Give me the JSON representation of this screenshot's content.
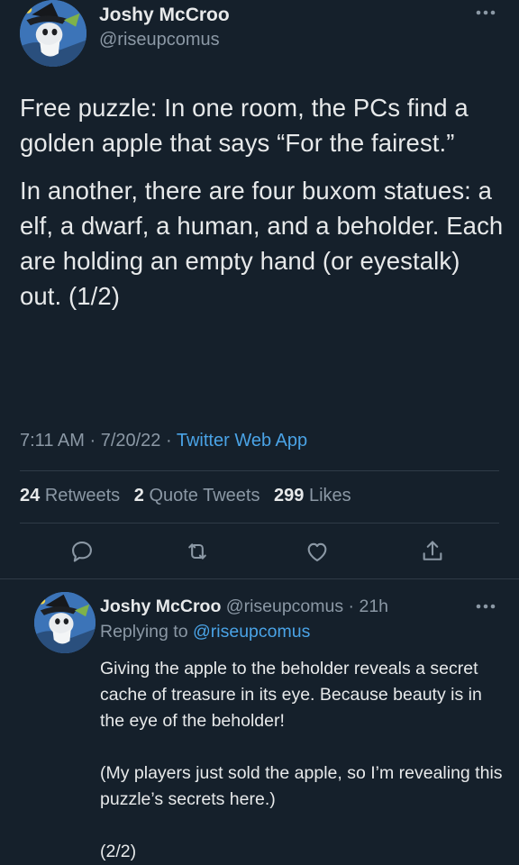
{
  "main_tweet": {
    "author": {
      "name": "Joshy McCroo",
      "handle": "@riseupcomus"
    },
    "body": [
      "Free puzzle: In one room, the PCs find a golden apple that says “For the fairest.”",
      "In another, there are four buxom statues: a elf, a dwarf, a human, and a beholder. Each are holding an empty hand (or eyestalk) out. (1/2)"
    ],
    "time": "7:11 AM",
    "date": "7/20/22",
    "separator": "·",
    "app": "Twitter Web App",
    "stats": {
      "retweets_count": "24",
      "retweets_label": "Retweets",
      "quotes_count": "2",
      "quotes_label": "Quote Tweets",
      "likes_count": "299",
      "likes_label": "Likes"
    },
    "actions": [
      "reply-icon",
      "retweet-icon",
      "like-icon",
      "share-icon"
    ]
  },
  "reply_tweet": {
    "author": {
      "name": "Joshy McCroo",
      "handle": "@riseupcomus",
      "age": "21h"
    },
    "separator": "·",
    "replying_label": "Replying to",
    "replying_to": "@riseupcomus",
    "body": [
      "Giving the apple to the beholder reveals a secret cache of treasure in its eye. Because beauty is in the eye of the beholder!",
      "(My players just sold the apple, so I’m revealing this puzzle’s secrets here.)",
      "(2/2)"
    ]
  },
  "colors": {
    "background": "#15202b",
    "text_primary": "#e7e9ea",
    "text_secondary": "#8b98a5",
    "link": "#4aa3e6",
    "divider": "#2f3b47"
  },
  "icons": {
    "more": "more-dots-icon"
  }
}
